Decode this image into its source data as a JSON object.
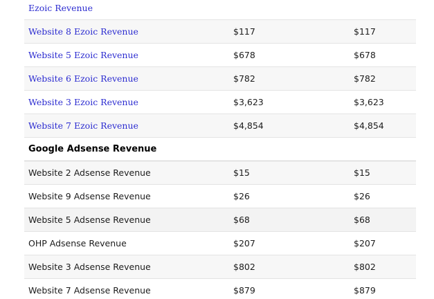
{
  "ezoic_section": {
    "header_link": "Ezoic Revenue",
    "rows": [
      {
        "label": "Website 8 Ezoic Revenue",
        "col1": "$117",
        "col2": "$117"
      },
      {
        "label": "Website 5 Ezoic Revenue",
        "col1": "$678",
        "col2": "$678"
      },
      {
        "label": "Website 6 Ezoic Revenue",
        "col1": "$782",
        "col2": "$782"
      },
      {
        "label": "Website 3 Ezoic Revenue",
        "col1": "$3,623",
        "col2": "$3,623"
      },
      {
        "label": "Website 7 Ezoic Revenue",
        "col1": "$4,854",
        "col2": "$4,854"
      }
    ]
  },
  "adsense_section": {
    "title": "Google Adsense Revenue",
    "rows": [
      {
        "label": "Website 2 Adsense Revenue",
        "col1": "$15",
        "col2": "$15"
      },
      {
        "label": "Website 9 Adsense Revenue",
        "col1": "$26",
        "col2": "$26"
      },
      {
        "label": "Website 5 Adsense Revenue",
        "col1": "$68",
        "col2": "$68"
      },
      {
        "label": "OHP Adsense Revenue",
        "col1": "$207",
        "col2": "$207"
      },
      {
        "label": "Website 3 Adsense Revenue",
        "col1": "$802",
        "col2": "$802"
      },
      {
        "label": "Website 7 Adsense Revenue",
        "col1": "$879",
        "col2": "$879"
      }
    ]
  }
}
